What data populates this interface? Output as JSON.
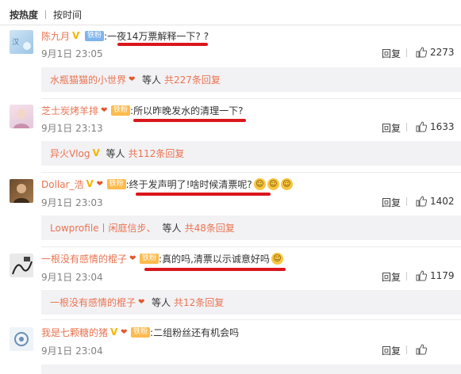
{
  "tabs": [
    "按热度",
    "按时间"
  ],
  "comments": [
    {
      "username": "陈九月",
      "fan_badge": "铁粉",
      "colon": ":",
      "text": "一夜14万票解释一下?",
      "trail": "?",
      "time": "9月1日 23:05",
      "reply_label": "回复",
      "likes": "2273",
      "sub": {
        "user": "水瓶猫猫的小世界",
        "etc": "等人",
        "count": "共227条回复"
      }
    },
    {
      "username": "芝士炭烤羊排",
      "fan_badge": "铁粉",
      "colon": ":",
      "text": "所以昨晚发水的清理一下?",
      "time": "9月1日 23:13",
      "reply_label": "回复",
      "likes": "1633",
      "sub": {
        "user": "异火Vlog",
        "etc": "等人",
        "count": "共112条回复"
      }
    },
    {
      "username": "Dollar_浩",
      "fan_badge": "铁粉",
      "colon": ":",
      "text": "终于发声明了!啥时候清票呢?",
      "time": "9月1日 23:03",
      "reply_label": "回复",
      "likes": "1402",
      "sub": {
        "user": "Lowprofile丨闲庭信步、",
        "etc": "等人",
        "count": "共48条回复"
      }
    },
    {
      "username": "一根没有感情的棍子",
      "fan_badge": "铁粉",
      "colon": ":",
      "text": "真的吗,清票以示诚意好吗",
      "time": "9月1日 23:04",
      "reply_label": "回复",
      "likes": "1179",
      "sub": {
        "user": "一根没有感情的棍子",
        "etc": "等人",
        "count": "共12条回复"
      }
    },
    {
      "username": "我是七颗糖的猪",
      "fan_badge": "铁粉",
      "colon": ":",
      "text": "二组粉丝还有机会吗",
      "time": "9月1日 23:04",
      "reply_label": "回复",
      "likes": ""
    }
  ],
  "colors": {
    "username": "#eb7350",
    "underline": "#d9171c",
    "subbox": "#f2f2f5"
  }
}
